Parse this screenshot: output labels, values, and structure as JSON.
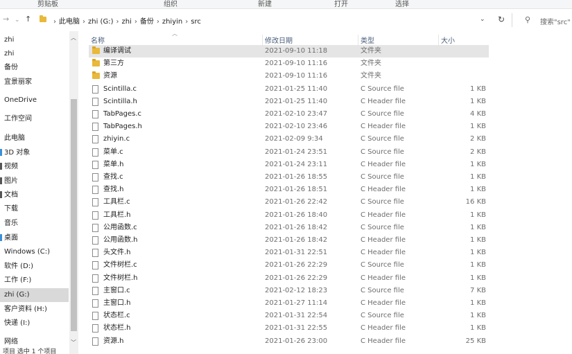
{
  "ribbon": {
    "groups": [
      "剪贴板",
      "组织",
      "新建",
      "打开",
      "选择"
    ]
  },
  "nav": {
    "back": "→",
    "dropdown": "⌄",
    "up": "↑"
  },
  "address": {
    "path": [
      "此电脑",
      "zhi (G:)",
      "zhi",
      "备份",
      "zhiyin",
      "src"
    ]
  },
  "search": {
    "placeholder": "搜索\"src\""
  },
  "sidebar": {
    "items": [
      {
        "label": "zhi",
        "pin": "",
        "selected": false
      },
      {
        "label": "zhi",
        "pin": "",
        "selected": false
      },
      {
        "label": "备份",
        "pin": "",
        "selected": false
      },
      {
        "label": "宜景丽家",
        "pin": "",
        "selected": false
      },
      {
        "label": "OneDrive",
        "pin": "",
        "selected": false
      },
      {
        "label": "工作空间",
        "pin": "",
        "selected": false
      },
      {
        "label": "此电脑",
        "pin": "",
        "selected": false
      },
      {
        "label": "3D 对象",
        "pin": "#3a8fd9",
        "selected": false
      },
      {
        "label": "视频",
        "pin": "#555555",
        "selected": false
      },
      {
        "label": "图片",
        "pin": "#555555",
        "selected": false
      },
      {
        "label": "文档",
        "pin": "#555555",
        "selected": false
      },
      {
        "label": "下载",
        "pin": "",
        "selected": false
      },
      {
        "label": "音乐",
        "pin": "",
        "selected": false
      },
      {
        "label": "桌面",
        "pin": "#3a8fd9",
        "selected": false
      },
      {
        "label": "Windows (C:)",
        "pin": "",
        "selected": false
      },
      {
        "label": "软件 (D:)",
        "pin": "",
        "selected": false
      },
      {
        "label": "工作 (F:)",
        "pin": "",
        "selected": false
      },
      {
        "label": "zhi (G:)",
        "pin": "",
        "selected": true
      },
      {
        "label": "客户资料 (H:)",
        "pin": "",
        "selected": false
      },
      {
        "label": "快递 (I:)",
        "pin": "",
        "selected": false
      },
      {
        "label": "网络",
        "pin": "",
        "selected": false
      }
    ]
  },
  "columns": {
    "name": "名称",
    "date": "修改日期",
    "type": "类型",
    "size": "大小"
  },
  "files": [
    {
      "name": "编译调试",
      "date": "2021-09-10 11:18",
      "type": "文件夹",
      "size": "",
      "kind": "folder"
    },
    {
      "name": "第三方",
      "date": "2021-09-10 11:16",
      "type": "文件夹",
      "size": "",
      "kind": "folder"
    },
    {
      "name": "资源",
      "date": "2021-09-10 11:16",
      "type": "文件夹",
      "size": "",
      "kind": "folder"
    },
    {
      "name": "Scintilla.c",
      "date": "2021-01-25 11:40",
      "type": "C Source file",
      "size": "1 KB",
      "kind": "file"
    },
    {
      "name": "Scintilla.h",
      "date": "2021-01-25 11:40",
      "type": "C Header file",
      "size": "1 KB",
      "kind": "file"
    },
    {
      "name": "TabPages.c",
      "date": "2021-02-10 23:47",
      "type": "C Source file",
      "size": "4 KB",
      "kind": "file"
    },
    {
      "name": "TabPages.h",
      "date": "2021-02-10 23:46",
      "type": "C Header file",
      "size": "1 KB",
      "kind": "file"
    },
    {
      "name": "zhiyin.c",
      "date": "2021-02-09 9:34",
      "type": "C Source file",
      "size": "2 KB",
      "kind": "file"
    },
    {
      "name": "菜单.c",
      "date": "2021-01-24 23:51",
      "type": "C Source file",
      "size": "2 KB",
      "kind": "file"
    },
    {
      "name": "菜单.h",
      "date": "2021-01-24 23:11",
      "type": "C Header file",
      "size": "1 KB",
      "kind": "file"
    },
    {
      "name": "查找.c",
      "date": "2021-01-26 18:55",
      "type": "C Source file",
      "size": "1 KB",
      "kind": "file"
    },
    {
      "name": "查找.h",
      "date": "2021-01-26 18:51",
      "type": "C Header file",
      "size": "1 KB",
      "kind": "file"
    },
    {
      "name": "工具栏.c",
      "date": "2021-01-26 22:42",
      "type": "C Source file",
      "size": "16 KB",
      "kind": "file"
    },
    {
      "name": "工具栏.h",
      "date": "2021-01-26 18:40",
      "type": "C Header file",
      "size": "1 KB",
      "kind": "file"
    },
    {
      "name": "公用函数.c",
      "date": "2021-01-26 18:42",
      "type": "C Source file",
      "size": "1 KB",
      "kind": "file"
    },
    {
      "name": "公用函数.h",
      "date": "2021-01-26 18:42",
      "type": "C Header file",
      "size": "1 KB",
      "kind": "file"
    },
    {
      "name": "头文件.h",
      "date": "2021-01-31 22:51",
      "type": "C Header file",
      "size": "1 KB",
      "kind": "file"
    },
    {
      "name": "文件树栏.c",
      "date": "2021-01-26 22:29",
      "type": "C Source file",
      "size": "1 KB",
      "kind": "file"
    },
    {
      "name": "文件树栏.h",
      "date": "2021-01-26 22:29",
      "type": "C Header file",
      "size": "1 KB",
      "kind": "file"
    },
    {
      "name": "主窗口.c",
      "date": "2021-02-12 18:23",
      "type": "C Source file",
      "size": "7 KB",
      "kind": "file"
    },
    {
      "name": "主窗口.h",
      "date": "2021-01-27 11:14",
      "type": "C Header file",
      "size": "1 KB",
      "kind": "file"
    },
    {
      "name": "状态栏.c",
      "date": "2021-01-31 22:54",
      "type": "C Source file",
      "size": "1 KB",
      "kind": "file"
    },
    {
      "name": "状态栏.h",
      "date": "2021-01-31 22:55",
      "type": "C Header file",
      "size": "1 KB",
      "kind": "file"
    },
    {
      "name": "资源.h",
      "date": "2021-01-26 23:00",
      "type": "C Header file",
      "size": "25 KB",
      "kind": "file"
    }
  ],
  "status": {
    "text": "项目    选中 1 个项目"
  }
}
